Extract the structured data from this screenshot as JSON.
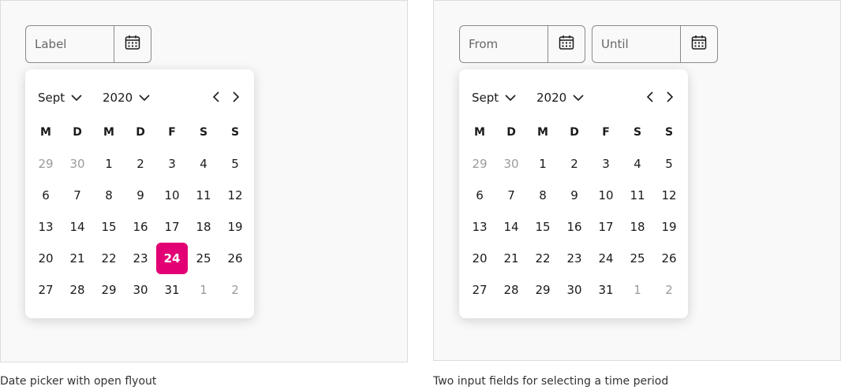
{
  "colors": {
    "accent": "#e20074",
    "panel_bg": "#f9f9f9"
  },
  "single_picker": {
    "input": {
      "placeholder": "Label",
      "value": ""
    },
    "calendar_icon": "calendar-icon",
    "month": "Sept",
    "year": "2020",
    "selected_day": "24",
    "caption": "Date picker with open flyout"
  },
  "range_picker": {
    "from": {
      "placeholder": "From",
      "value": ""
    },
    "until": {
      "placeholder": "Until",
      "value": ""
    },
    "calendar_icon": "calendar-icon",
    "month": "Sept",
    "year": "2020",
    "caption": "Two input fields for selecting a time period"
  },
  "weekdays": [
    "M",
    "D",
    "M",
    "D",
    "F",
    "S",
    "S"
  ],
  "weeks": [
    [
      {
        "d": "29",
        "out": true
      },
      {
        "d": "30",
        "out": true
      },
      {
        "d": "1"
      },
      {
        "d": "2"
      },
      {
        "d": "3"
      },
      {
        "d": "4"
      },
      {
        "d": "5"
      }
    ],
    [
      {
        "d": "6"
      },
      {
        "d": "7"
      },
      {
        "d": "8"
      },
      {
        "d": "9"
      },
      {
        "d": "10"
      },
      {
        "d": "11"
      },
      {
        "d": "12"
      }
    ],
    [
      {
        "d": "13"
      },
      {
        "d": "14"
      },
      {
        "d": "15"
      },
      {
        "d": "16"
      },
      {
        "d": "17"
      },
      {
        "d": "18"
      },
      {
        "d": "19"
      }
    ],
    [
      {
        "d": "20"
      },
      {
        "d": "21"
      },
      {
        "d": "22"
      },
      {
        "d": "23"
      },
      {
        "d": "24"
      },
      {
        "d": "25"
      },
      {
        "d": "26"
      }
    ],
    [
      {
        "d": "27"
      },
      {
        "d": "28"
      },
      {
        "d": "29"
      },
      {
        "d": "30"
      },
      {
        "d": "31"
      },
      {
        "d": "1",
        "out": true
      },
      {
        "d": "2",
        "out": true
      }
    ]
  ]
}
